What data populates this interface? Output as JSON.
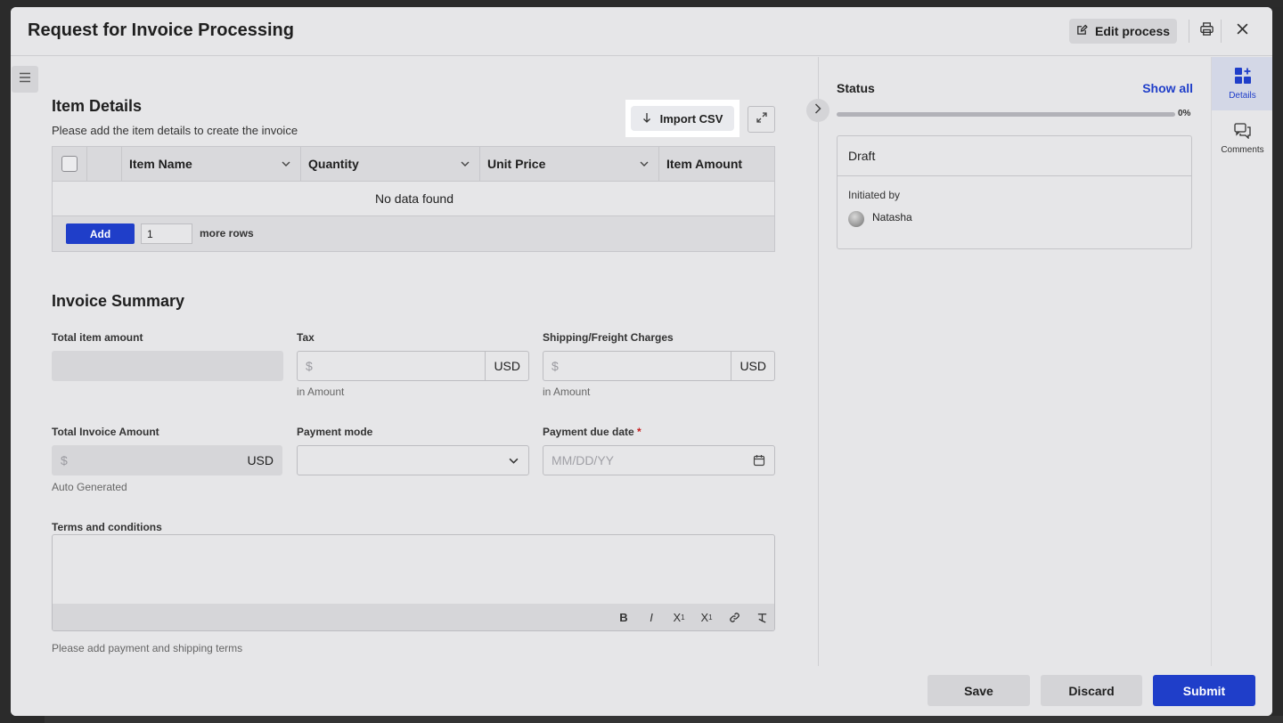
{
  "header": {
    "title": "Request for Invoice Processing",
    "edit_process_label": "Edit process"
  },
  "item_details": {
    "title": "Item Details",
    "subtitle": "Please add the item details to create the invoice",
    "import_csv_label": "Import CSV",
    "columns": [
      "Item Name",
      "Quantity",
      "Unit Price",
      "Item Amount"
    ],
    "empty_text": "No data found",
    "add_label": "Add",
    "rows_value": "1",
    "more_rows_label": "more rows"
  },
  "invoice_summary": {
    "title": "Invoice Summary",
    "total_item_amount_label": "Total item amount",
    "tax_label": "Tax",
    "tax_prefix": "$",
    "tax_currency": "USD",
    "tax_hint": "in Amount",
    "shipping_label": "Shipping/Freight Charges",
    "shipping_prefix": "$",
    "shipping_currency": "USD",
    "shipping_hint": "in Amount",
    "total_invoice_label": "Total Invoice Amount",
    "total_invoice_prefix": "$",
    "total_invoice_currency": "USD",
    "total_invoice_hint": "Auto Generated",
    "payment_mode_label": "Payment mode",
    "payment_due_label": "Payment due date",
    "payment_due_required": "*",
    "payment_due_placeholder": "MM/DD/YY",
    "terms_label": "Terms and conditions",
    "terms_hint": "Please add payment and shipping terms"
  },
  "status_panel": {
    "status_label": "Status",
    "show_all_label": "Show all",
    "progress_percent": 0,
    "progress_text": "0%",
    "stage": "Draft",
    "initiated_by_label": "Initiated by",
    "initiator_name": "Natasha"
  },
  "rail": {
    "details_label": "Details",
    "comments_label": "Comments"
  },
  "footer": {
    "save_label": "Save",
    "discard_label": "Discard",
    "submit_label": "Submit"
  },
  "colors": {
    "accent": "#1f3ec9",
    "required": "#c81e1e"
  }
}
